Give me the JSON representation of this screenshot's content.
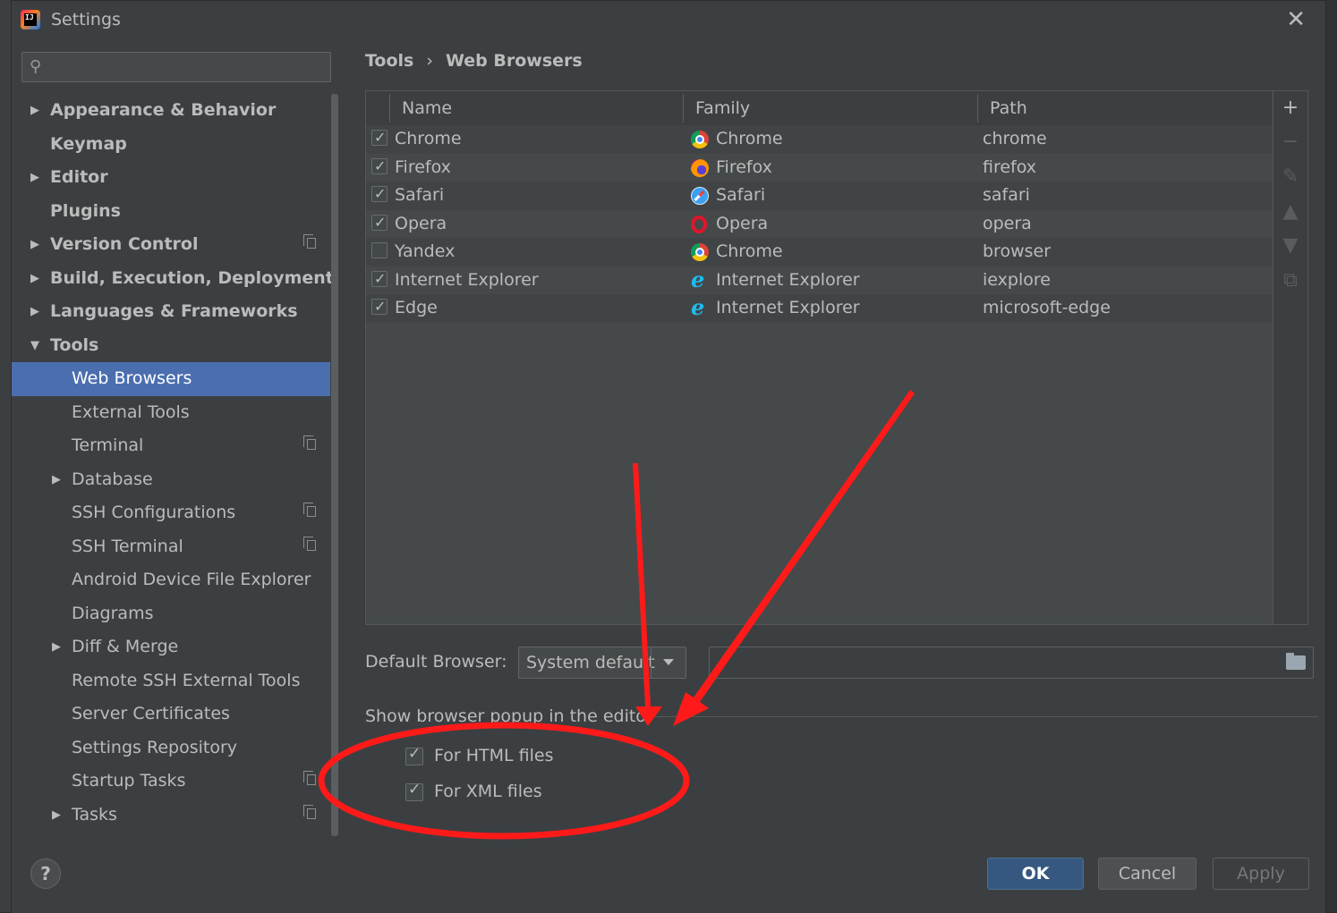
{
  "window": {
    "title": "Settings"
  },
  "search": {
    "placeholder": ""
  },
  "sidebar": {
    "items": [
      {
        "label": "Appearance & Behavior",
        "level": 0,
        "expandable": true,
        "expanded": false,
        "bold": true,
        "has_copy": false
      },
      {
        "label": "Keymap",
        "level": 0,
        "expandable": false,
        "bold": true,
        "has_copy": false
      },
      {
        "label": "Editor",
        "level": 0,
        "expandable": true,
        "expanded": false,
        "bold": true,
        "has_copy": false
      },
      {
        "label": "Plugins",
        "level": 0,
        "expandable": false,
        "bold": true,
        "has_copy": false
      },
      {
        "label": "Version Control",
        "level": 0,
        "expandable": true,
        "expanded": false,
        "bold": true,
        "has_copy": true
      },
      {
        "label": "Build, Execution, Deployment",
        "level": 0,
        "expandable": true,
        "expanded": false,
        "bold": true,
        "has_copy": false
      },
      {
        "label": "Languages & Frameworks",
        "level": 0,
        "expandable": true,
        "expanded": false,
        "bold": true,
        "has_copy": false
      },
      {
        "label": "Tools",
        "level": 0,
        "expandable": true,
        "expanded": true,
        "bold": true,
        "has_copy": false
      },
      {
        "label": "Web Browsers",
        "level": 1,
        "expandable": false,
        "selected": true,
        "has_copy": false
      },
      {
        "label": "External Tools",
        "level": 1,
        "expandable": false,
        "has_copy": false
      },
      {
        "label": "Terminal",
        "level": 1,
        "expandable": false,
        "has_copy": true
      },
      {
        "label": "Database",
        "level": 1,
        "expandable": true,
        "expanded": false,
        "has_copy": false
      },
      {
        "label": "SSH Configurations",
        "level": 1,
        "expandable": false,
        "has_copy": true
      },
      {
        "label": "SSH Terminal",
        "level": 1,
        "expandable": false,
        "has_copy": true
      },
      {
        "label": "Android Device File Explorer",
        "level": 1,
        "expandable": false,
        "has_copy": false
      },
      {
        "label": "Diagrams",
        "level": 1,
        "expandable": false,
        "has_copy": false
      },
      {
        "label": "Diff & Merge",
        "level": 1,
        "expandable": true,
        "expanded": false,
        "has_copy": false
      },
      {
        "label": "Remote SSH External Tools",
        "level": 1,
        "expandable": false,
        "has_copy": false
      },
      {
        "label": "Server Certificates",
        "level": 1,
        "expandable": false,
        "has_copy": false
      },
      {
        "label": "Settings Repository",
        "level": 1,
        "expandable": false,
        "has_copy": false
      },
      {
        "label": "Startup Tasks",
        "level": 1,
        "expandable": false,
        "has_copy": true
      },
      {
        "label": "Tasks",
        "level": 1,
        "expandable": true,
        "expanded": false,
        "has_copy": true
      }
    ]
  },
  "breadcrumb": {
    "parent": "Tools",
    "separator": "›",
    "current": "Web Browsers"
  },
  "table": {
    "columns": [
      "Name",
      "Family",
      "Path"
    ],
    "rows": [
      {
        "checked": true,
        "name": "Chrome",
        "family_icon": "chrome",
        "family": "Chrome",
        "path": "chrome"
      },
      {
        "checked": true,
        "name": "Firefox",
        "family_icon": "firefox",
        "family": "Firefox",
        "path": "firefox"
      },
      {
        "checked": true,
        "name": "Safari",
        "family_icon": "safari",
        "family": "Safari",
        "path": "safari"
      },
      {
        "checked": true,
        "name": "Opera",
        "family_icon": "opera",
        "family": "Opera",
        "path": "opera"
      },
      {
        "checked": false,
        "name": "Yandex",
        "family_icon": "chrome",
        "family": "Chrome",
        "path": "browser"
      },
      {
        "checked": true,
        "name": "Internet Explorer",
        "family_icon": "ie",
        "family": "Internet Explorer",
        "path": "iexplore"
      },
      {
        "checked": true,
        "name": "Edge",
        "family_icon": "ie",
        "family": "Internet Explorer",
        "path": "microsoft-edge"
      }
    ],
    "tools": [
      {
        "name": "add-icon",
        "glyph": "+",
        "enabled": true
      },
      {
        "name": "remove-icon",
        "glyph": "−",
        "enabled": false
      },
      {
        "name": "edit-icon",
        "glyph": "✎",
        "enabled": false
      },
      {
        "name": "move-up-icon",
        "glyph": "▲",
        "enabled": false
      },
      {
        "name": "move-down-icon",
        "glyph": "▼",
        "enabled": false
      },
      {
        "name": "copy-icon",
        "glyph": "⧉",
        "enabled": false
      }
    ]
  },
  "default_browser": {
    "label": "Default Browser:",
    "value": "System default",
    "path_value": ""
  },
  "popup_group": {
    "title": "Show browser popup in the editor",
    "options": [
      {
        "label": "For HTML files",
        "checked": true
      },
      {
        "label": "For XML files",
        "checked": true
      }
    ]
  },
  "footer": {
    "help": "?",
    "ok": "OK",
    "cancel": "Cancel",
    "apply": "Apply",
    "apply_enabled": false
  },
  "colors": {
    "selection": "#4b6eaf",
    "annotation": "#ff1a1a",
    "ok_button": "#365880"
  }
}
